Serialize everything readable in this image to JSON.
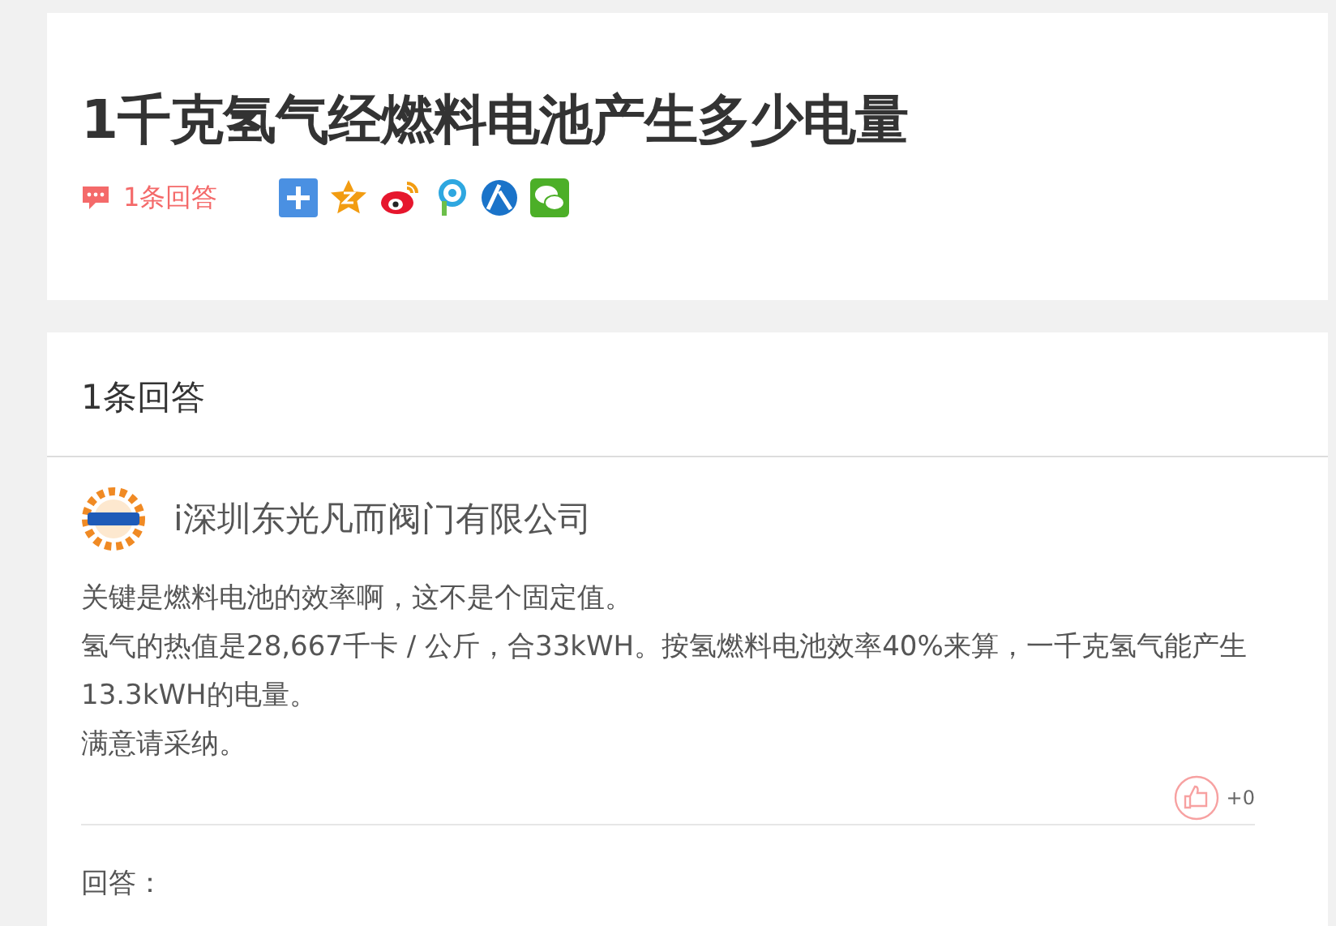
{
  "question": {
    "title": "1千克氢气经燃料电池产生多少电量",
    "answer_count": "1条回答"
  },
  "answers_header": "1条回答",
  "answer": {
    "author": "i深圳东光凡而阀门有限公司",
    "paragraphs": [
      "关键是燃料电池的效率啊，这不是个固定值。",
      "氢气的热值是28,667千卡 / 公斤，合33kWH。按氢燃料电池效率40%来算，一千克氢气能产生13.3kWH的电量。",
      "满意请采纳。"
    ],
    "likes": "+0"
  },
  "reply_label": "回答："
}
